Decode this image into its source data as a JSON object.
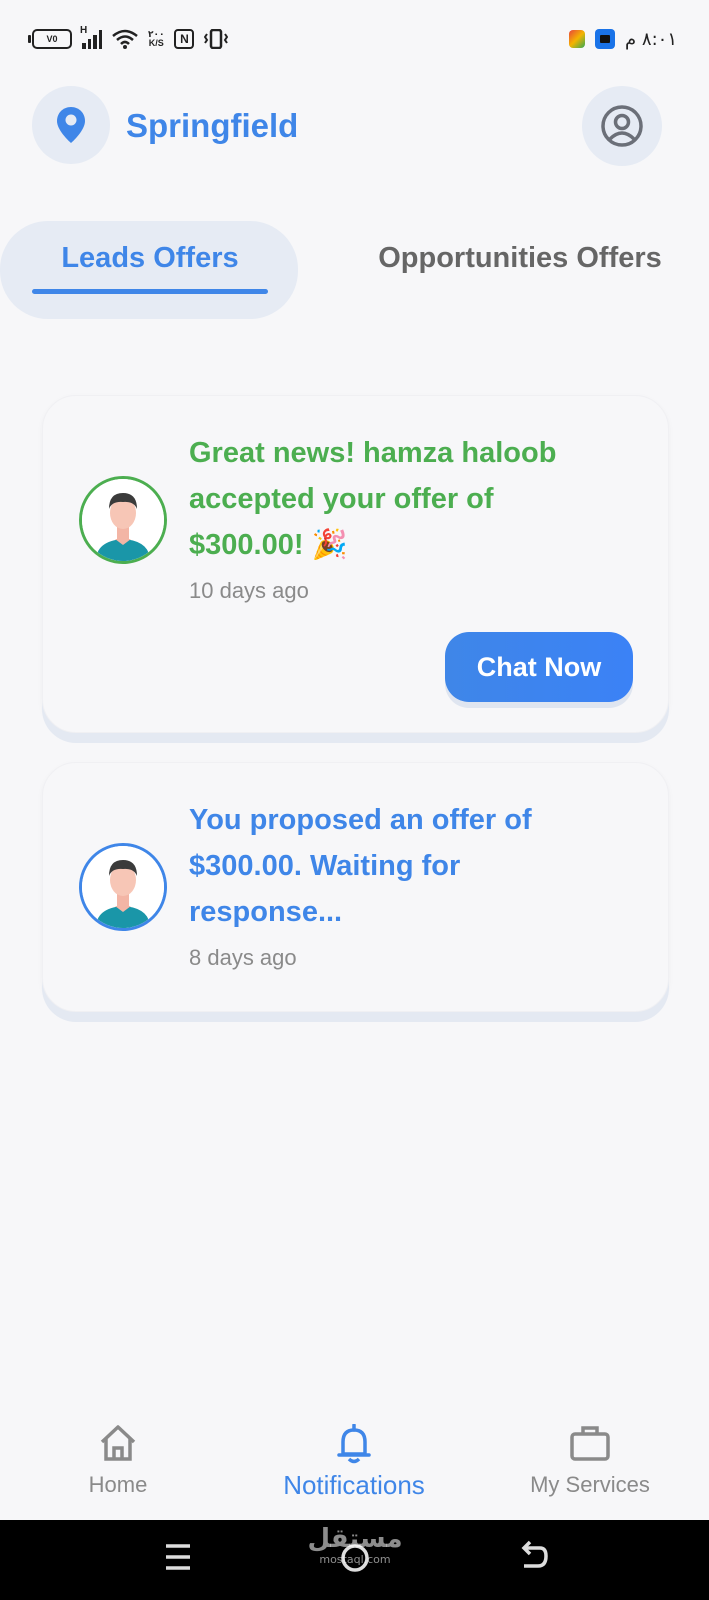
{
  "status_bar": {
    "battery": "V0",
    "network_type": "H",
    "speed_value": "٢٠٠",
    "speed_unit": "K/S",
    "nfc": "N",
    "time": "٨:٠١ م"
  },
  "header": {
    "city": "Springfield",
    "location_icon": "map-pin-icon",
    "profile_icon": "user-circle-icon"
  },
  "tabs": [
    {
      "label": "Leads Offers",
      "active": true
    },
    {
      "label": "Opportunities Offers",
      "active": false
    }
  ],
  "notifications": [
    {
      "message": "Great news! hamza haloob accepted your offer of $300.00! 🎉",
      "time": "10 days ago",
      "action": "Chat Now",
      "status_color": "#4cae50"
    },
    {
      "message": "You proposed an offer of $300.00. Waiting for response...",
      "time": "8 days ago",
      "status_color": "#3f86e8"
    }
  ],
  "bottom_nav": [
    {
      "label": "Home",
      "icon": "home-icon",
      "active": false
    },
    {
      "label": "Notifications",
      "icon": "bell-icon",
      "active": true
    },
    {
      "label": "My Services",
      "icon": "briefcase-icon",
      "active": false
    }
  ],
  "watermark": {
    "arabic": "مستقل",
    "latin": "mostaql.com"
  },
  "colors": {
    "accent": "#3f86e8",
    "success": "#4cae50",
    "muted": "#8a8a8a",
    "chip_bg": "#e6ebf4"
  }
}
